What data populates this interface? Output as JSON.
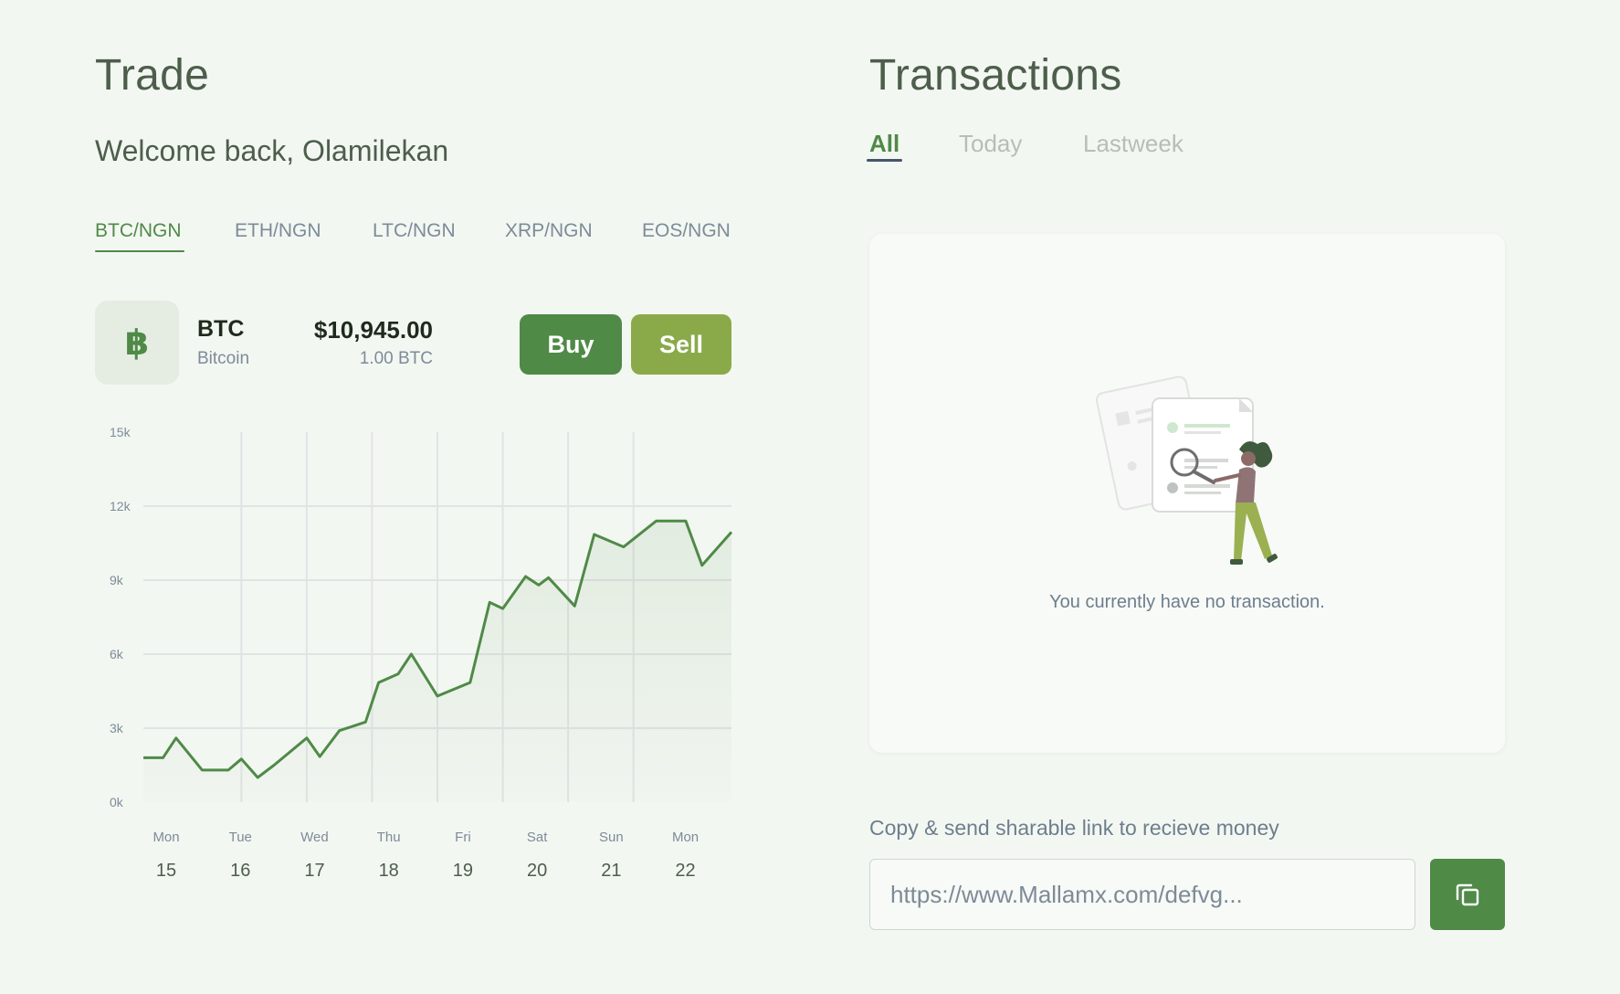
{
  "trade": {
    "title": "Trade",
    "welcome": "Welcome back, Olamilekan",
    "pairs": [
      "BTC/NGN",
      "ETH/NGN",
      "LTC/NGN",
      "XRP/NGN",
      "EOS/NGN"
    ],
    "active_pair": "BTC/NGN",
    "coin": {
      "icon": "bitcoin-icon",
      "icon_glyph": "฿",
      "symbol": "BTC",
      "name": "Bitcoin",
      "price": "$10,945.00",
      "amount": "1.00 BTC"
    },
    "buy_label": "Buy",
    "sell_label": "Sell",
    "colors": {
      "accent": "#4f8a47",
      "sell": "#8aaa4a"
    }
  },
  "chart_data": {
    "type": "area",
    "y_ticks": [
      "15k",
      "12k",
      "9k",
      "6k",
      "3k",
      "0k"
    ],
    "ylim": [
      0,
      15000
    ],
    "x_days": [
      "Mon",
      "Tue",
      "Wed",
      "Thu",
      "Fri",
      "Sat",
      "Sun",
      "Mon"
    ],
    "x_dates": [
      "15",
      "16",
      "17",
      "18",
      "19",
      "20",
      "21",
      "22"
    ],
    "series": [
      {
        "color": "#4f8a47",
        "points": [
          [
            0.0,
            1800
          ],
          [
            0.3,
            1800
          ],
          [
            0.5,
            2600
          ],
          [
            0.9,
            1300
          ],
          [
            1.3,
            1300
          ],
          [
            1.5,
            1750
          ],
          [
            1.75,
            1000
          ],
          [
            2.0,
            1500
          ],
          [
            2.5,
            2600
          ],
          [
            2.7,
            1850
          ],
          [
            3.0,
            2900
          ],
          [
            3.4,
            3250
          ],
          [
            3.6,
            4850
          ],
          [
            3.9,
            5200
          ],
          [
            4.1,
            6000
          ],
          [
            4.5,
            4300
          ],
          [
            5.0,
            4850
          ],
          [
            5.3,
            8100
          ],
          [
            5.5,
            7850
          ],
          [
            5.85,
            9150
          ],
          [
            6.05,
            8800
          ],
          [
            6.2,
            9100
          ],
          [
            6.6,
            7950
          ],
          [
            6.9,
            10850
          ],
          [
            7.35,
            10350
          ],
          [
            7.85,
            11400
          ],
          [
            8.3,
            11400
          ],
          [
            8.55,
            9600
          ],
          [
            9.0,
            10950
          ]
        ]
      }
    ],
    "grid": true
  },
  "transactions": {
    "title": "Transactions",
    "tabs": [
      "All",
      "Today",
      "Lastweek"
    ],
    "active_tab": "All",
    "empty_message": "You currently have no transaction.",
    "illustration": "empty-search-illustration"
  },
  "share": {
    "label": "Copy & send sharable link to recieve money",
    "link_value": "https://www.Mallamx.com/defvg...",
    "copy_icon": "copy-icon"
  }
}
